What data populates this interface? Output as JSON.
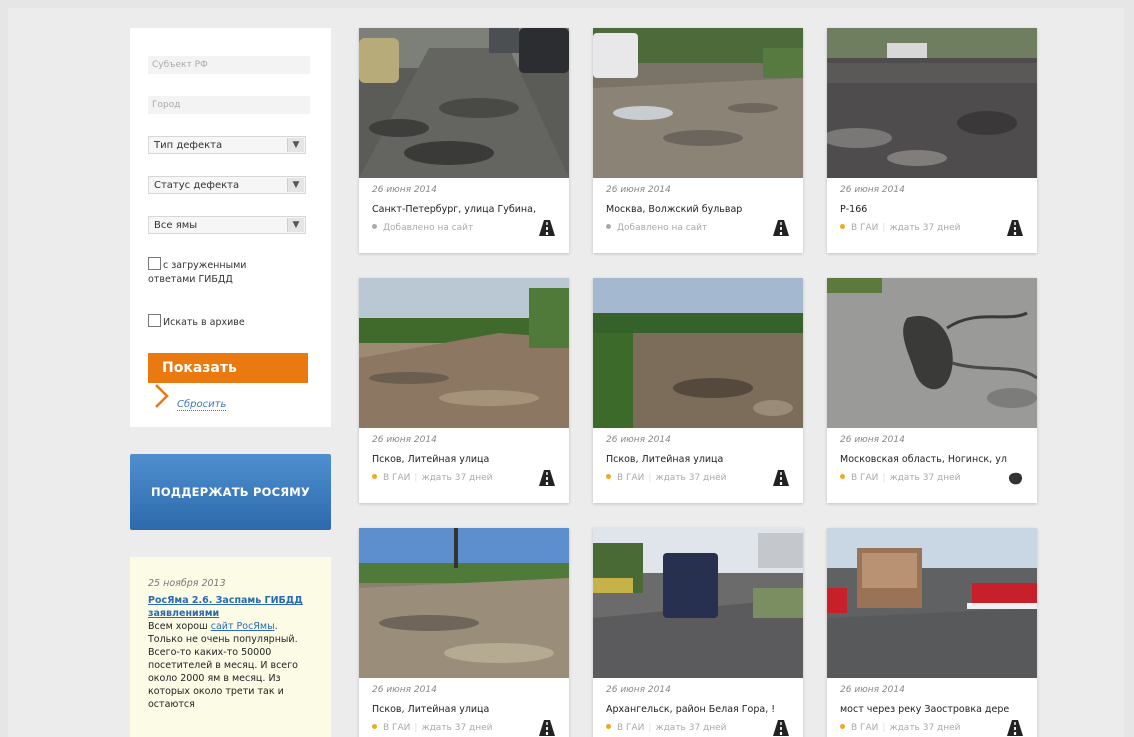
{
  "colors": {
    "accent_orange": "#ea7a10",
    "support_blue": "#2c6aab",
    "link_blue": "#2a6ab5",
    "dot_gray": "#aaaaaa",
    "dot_orange": "#f5a623"
  },
  "filters": {
    "region_placeholder": "Субъект РФ",
    "city_placeholder": "Город",
    "defect_type": "Тип дефекта",
    "defect_status": "Статус дефекта",
    "pits": "Все ямы",
    "gibdd_checkbox_label": "с загруженными ответами ГИБДД",
    "archive_checkbox_label": "Искать в архиве",
    "show_button": "Показать",
    "reset_link": "Сбросить"
  },
  "support_button": "ПОДДЕРЖАТЬ РОСЯМУ",
  "news": {
    "date": "25 ноября 2013",
    "title": "РосЯма 2.6. Заспамь ГИБДД заявлениями",
    "text_before_link": "Всем хорош ",
    "link_text": "сайт РосЯмы",
    "text_after_link": ". Только не очень популярный. Всего-то каких-то 50000 посетителей в месяц. И всего около 2000 ям в месяц. Из которых около трети так и остаются"
  },
  "cards": [
    {
      "date": "26 июня 2014",
      "title": "Санкт-Петербург, улица Губина,",
      "status": "Добавлено на сайт",
      "wait": "",
      "dot": "gray",
      "icon": "road-icon"
    },
    {
      "date": "26 июня 2014",
      "title": "Москва, Волжский бульвар",
      "status": "Добавлено на сайт",
      "wait": "",
      "dot": "gray",
      "icon": "road-icon"
    },
    {
      "date": "26 июня 2014",
      "title": "Р-166",
      "status": "В ГАИ",
      "wait": "ждать 37 дней",
      "dot": "orange",
      "icon": "road-icon"
    },
    {
      "date": "26 июня 2014",
      "title": "Псков, Литейная улица",
      "status": "В ГАИ",
      "wait": "ждать 37 дней",
      "dot": "orange",
      "icon": "road-icon"
    },
    {
      "date": "26 июня 2014",
      "title": "Псков, Литейная улица",
      "status": "В ГАИ",
      "wait": "ждать 37 дней",
      "dot": "orange",
      "icon": "road-icon"
    },
    {
      "date": "26 июня 2014",
      "title": "Московская область, Ногинск, ул",
      "status": "В ГАИ",
      "wait": "ждать 37 дней",
      "dot": "orange",
      "icon": "pothole-icon"
    },
    {
      "date": "26 июня 2014",
      "title": "Псков, Литейная улица",
      "status": "В ГАИ",
      "wait": "ждать 37 дней",
      "dot": "orange",
      "icon": "road-icon"
    },
    {
      "date": "26 июня 2014",
      "title": "Архангельск, район Белая Гора, !",
      "status": "В ГАИ",
      "wait": "ждать 37 дней",
      "dot": "orange",
      "icon": "road-icon"
    },
    {
      "date": "26 июня 2014",
      "title": "мост через реку Заостровка дере",
      "status": "В ГАИ",
      "wait": "ждать 37 дней",
      "dot": "orange",
      "icon": "road-icon"
    }
  ]
}
